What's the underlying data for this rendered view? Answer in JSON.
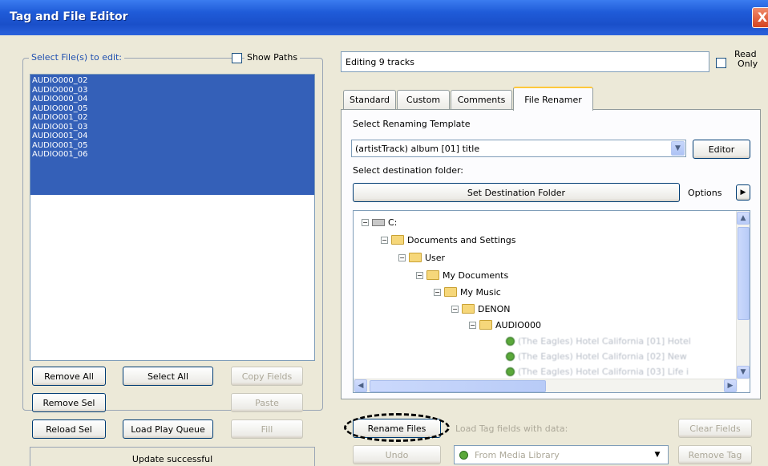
{
  "window": {
    "title": "Tag and File Editor",
    "close_label": "X"
  },
  "left": {
    "group_label": "Select File(s) to edit:",
    "show_paths_label": "Show Paths",
    "files": [
      "AUDIO000_02",
      "AUDIO000_03",
      "AUDIO000_04",
      "AUDIO000_05",
      "AUDIO001_02",
      "AUDIO001_03",
      "AUDIO001_04",
      "AUDIO001_05",
      "AUDIO001_06"
    ],
    "buttons": {
      "remove_all": "Remove All",
      "select_all": "Select All",
      "copy_fields": "Copy Fields",
      "remove_sel": "Remove Sel",
      "paste": "Paste",
      "reload_sel": "Reload Sel",
      "load_play_queue": "Load Play Queue",
      "fill": "Fill"
    },
    "status": "Update successful"
  },
  "right": {
    "editing_text": "Editing 9 tracks",
    "read_only_label_1": "Read",
    "read_only_label_2": "Only",
    "tabs": [
      "Standard",
      "Custom",
      "Comments",
      "File Renamer"
    ],
    "active_tab": "File Renamer",
    "template_label": "Select Renaming Template",
    "template_value": "(artistTrack) album [01] title",
    "editor_button": "Editor",
    "dest_label": "Select destination folder:",
    "set_dest_button": "Set Destination Folder",
    "options_label": "Options",
    "tree": {
      "drive": "C:",
      "n1": "Documents and Settings",
      "n2": "User",
      "n3": "My Documents",
      "n4": "My Music",
      "n5": "DENON",
      "n6": "AUDIO000",
      "f1": "(The Eagles) Hotel California [01] Hotel",
      "f2": "(The Eagles) Hotel California [02] New",
      "f3": "(The Eagles) Hotel California [03] Life i"
    },
    "bottom": {
      "rename_files": "Rename Files",
      "undo": "Undo",
      "load_tag_label": "Load Tag fields with data:",
      "source_value": "From Media Library",
      "clear_fields": "Clear Fields",
      "remove_tag": "Remove Tag"
    }
  },
  "colors": {
    "selection": "#3460b8",
    "titlebar": "#1f5bd8",
    "accent_tab": "#ffc83c"
  }
}
